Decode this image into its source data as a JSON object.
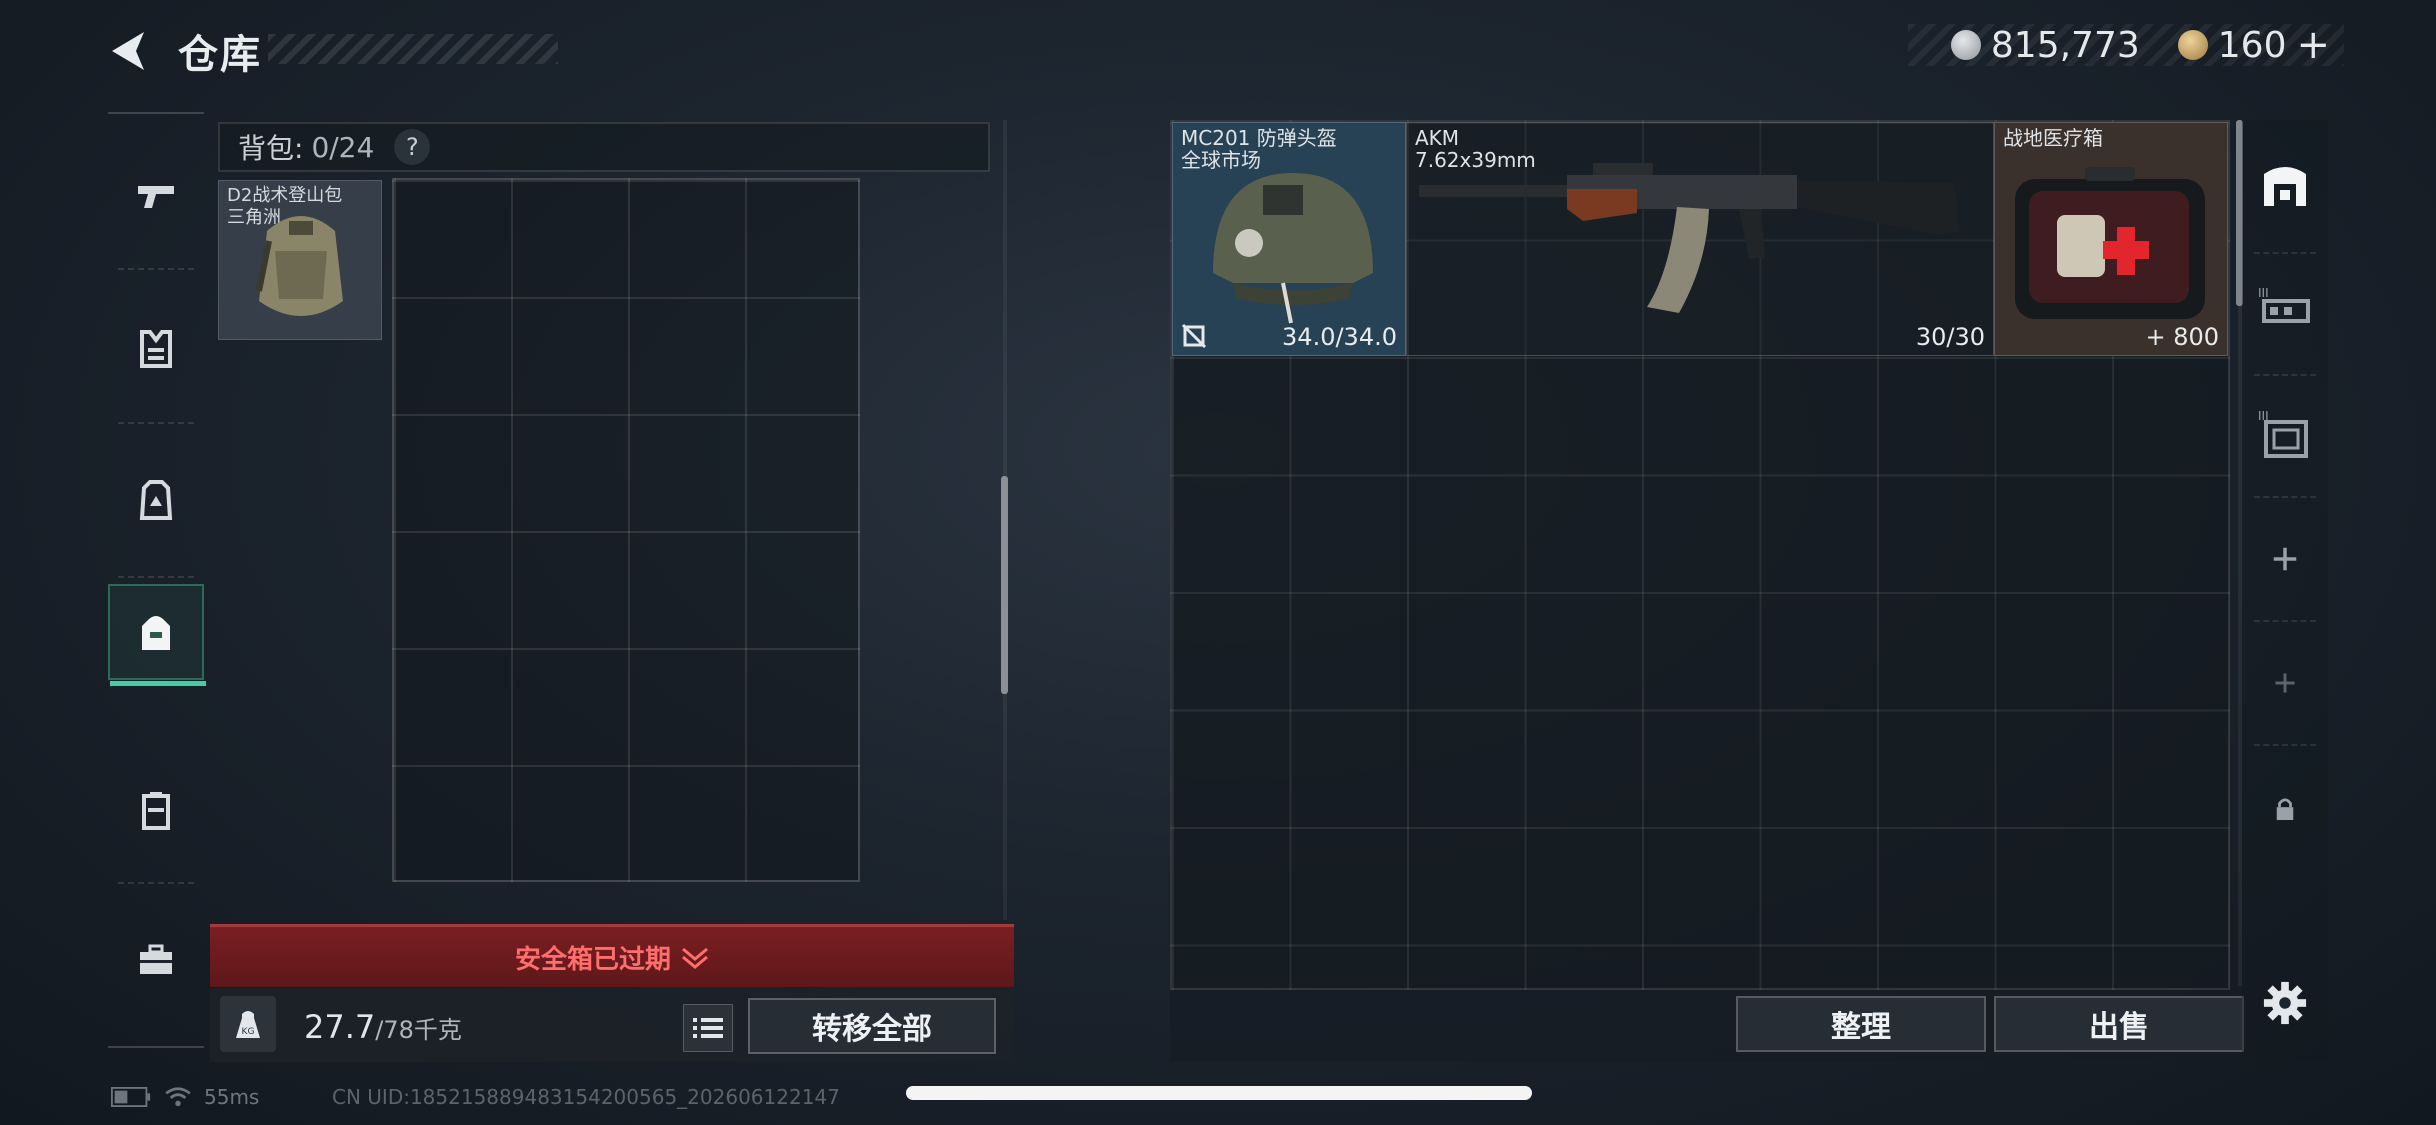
{
  "header": {
    "title": "仓库",
    "currency_silver": "815,773",
    "currency_gold": "160"
  },
  "sidebar": {
    "items": [
      {
        "icon": "pistol-icon"
      },
      {
        "icon": "armor-vest-icon"
      },
      {
        "icon": "chest-rig-icon"
      },
      {
        "icon": "backpack-icon",
        "active": true
      },
      {
        "icon": "container-icon"
      },
      {
        "icon": "toolbox-icon"
      }
    ]
  },
  "backpack": {
    "label": "背包:",
    "count": "0/24",
    "help": "?",
    "item_name": "D2战术登山包",
    "item_sub": "三角洲"
  },
  "safe_box": {
    "text": "安全箱已过期"
  },
  "footer": {
    "weight_icon_label": "KG",
    "weight_value": "27.7",
    "weight_max": "/78千克",
    "transfer_label": "转移全部"
  },
  "storage": {
    "items": [
      {
        "name": "MC201 防弹头盔",
        "sub": "全球市场",
        "value": "34.0/34.0"
      },
      {
        "name": "AKM",
        "sub": "7.62x39mm",
        "value": "30/30"
      },
      {
        "name": "战地医疗箱",
        "sub": "",
        "value": "800"
      }
    ],
    "sort_label": "整理",
    "sell_label": "出售"
  },
  "status": {
    "ping": "55ms",
    "uid": "CN UID:185215889483154200565_202606122147"
  },
  "colors": {
    "accent": "#3fd0a6",
    "warning": "#ff6d6d",
    "safe_bg": "#6e1c1e"
  }
}
